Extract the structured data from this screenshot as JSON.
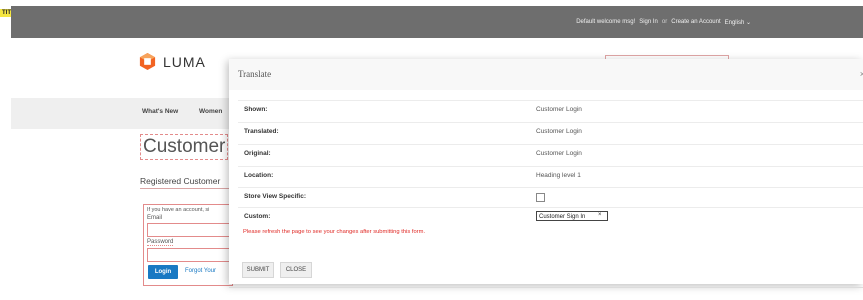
{
  "title_tag": "TITLE",
  "topbar": {
    "welcome": "Default welcome msg!",
    "sign_in": "Sign In",
    "or": "or",
    "create_account": "Create an Account",
    "language": "English ⌄"
  },
  "logo": {
    "text": "LUMA"
  },
  "nav": {
    "items": [
      "What's New",
      "Women"
    ]
  },
  "page": {
    "title": "Customer",
    "registered": "Registered Customer",
    "info": "If you have an account, si",
    "email_label": "Email",
    "password_label": "Password",
    "login_label": "Login",
    "forgot_label": "Forgot Your"
  },
  "modal": {
    "title": "Translate",
    "close": "×",
    "rows": [
      {
        "label": "Shown:",
        "value": "Customer Login"
      },
      {
        "label": "Translated:",
        "value": "Customer Login"
      },
      {
        "label": "Original:",
        "value": "Customer Login"
      },
      {
        "label": "Location:",
        "value": "Heading level 1"
      },
      {
        "label": "Store View Specific:",
        "value": ""
      },
      {
        "label": "Custom:",
        "value": "Customer Sign In"
      }
    ],
    "clear_icon": "×",
    "warning": "Please refresh the page to see your changes after submitting this form.",
    "submit": "SUBMIT",
    "close_button": "CLOSE"
  },
  "colors": {
    "topbar": "#6e6e6e",
    "link": "#1979c3",
    "warning": "#e02b27",
    "logo_orange": "#f26322"
  }
}
